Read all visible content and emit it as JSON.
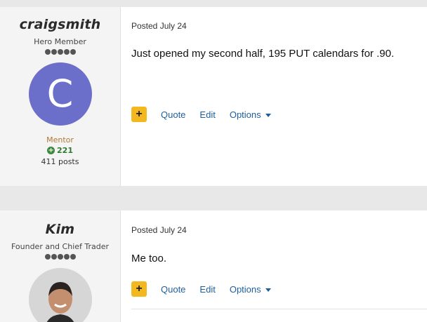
{
  "posts": [
    {
      "author": {
        "username": "craigsmith",
        "rank": "Hero Member",
        "avatar_letter": "C",
        "badge": "Mentor",
        "reputation": "221",
        "post_count": "411 posts"
      },
      "posted": "Posted July 24",
      "text": "Just opened my second half, 195 PUT calendars for .90.",
      "actions": {
        "plus": "+",
        "quote": "Quote",
        "edit": "Edit",
        "options": "Options"
      }
    },
    {
      "author": {
        "username": "Kim",
        "rank": "Founder and Chief Trader"
      },
      "posted": "Posted July 24",
      "text": "Me too.",
      "actions": {
        "plus": "+",
        "quote": "Quote",
        "edit": "Edit",
        "options": "Options"
      }
    }
  ],
  "colors": {
    "avatar_bg": "#6c6fca",
    "plus_button": "#f3b820",
    "link": "#1d5f9c",
    "mentor": "#b07a32",
    "reputation": "#2d7a2d"
  }
}
